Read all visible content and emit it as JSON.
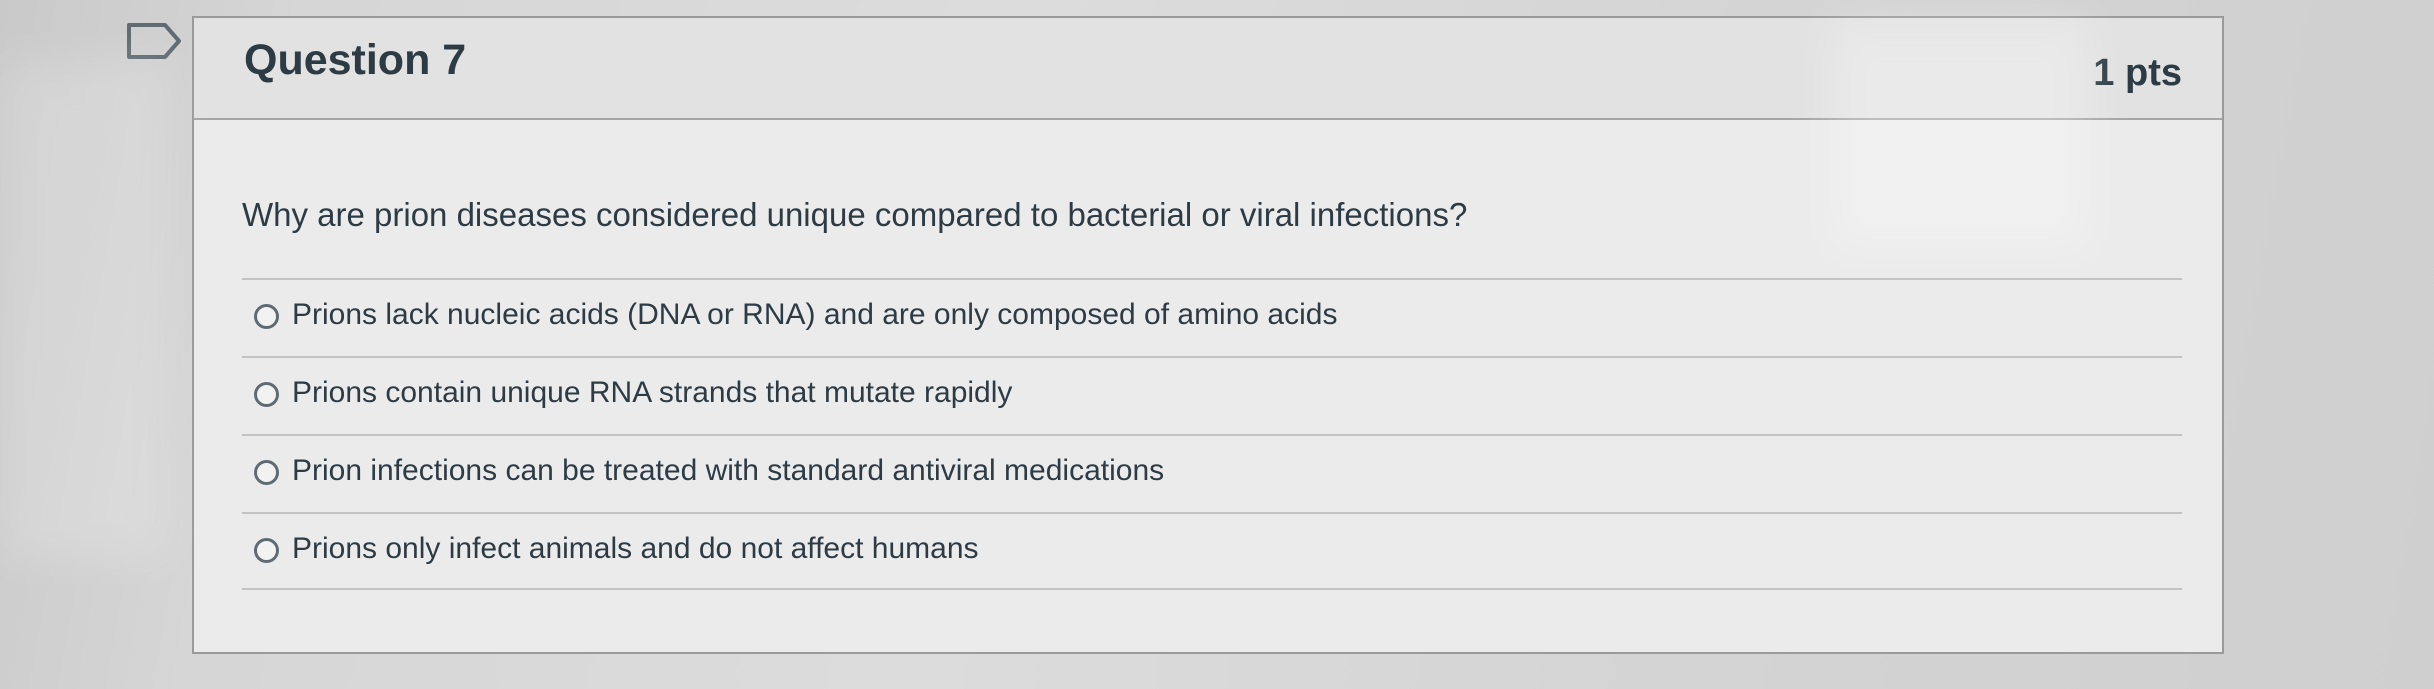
{
  "question": {
    "title": "Question 7",
    "points": "1 pts",
    "bookmark_icon": "bookmark-icon",
    "text": "Why are prion diseases considered unique compared to bacterial or viral infections?",
    "answers": [
      {
        "label": "Prions lack nucleic acids (DNA or RNA) and are only composed of amino acids",
        "selected": false
      },
      {
        "label": "Prions contain unique RNA strands that mutate rapidly",
        "selected": false
      },
      {
        "label": "Prion infections can be treated with standard antiviral medications",
        "selected": false
      },
      {
        "label": "Prions only infect animals and do not affect humans",
        "selected": false
      }
    ]
  },
  "colors": {
    "text": "#2d3b45",
    "card_background": "#ebebeb",
    "header_background": "#e2e2e2",
    "border": "#9a9a9a"
  }
}
